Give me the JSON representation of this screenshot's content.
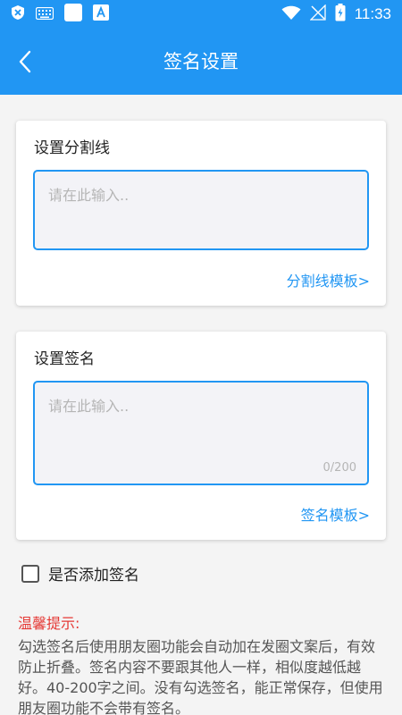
{
  "status_bar": {
    "time": "11:33"
  },
  "header": {
    "title": "签名设置"
  },
  "divider_card": {
    "title": "设置分割线",
    "placeholder": "请在此输入..",
    "template_link": "分割线模板>"
  },
  "signature_card": {
    "title": "设置签名",
    "placeholder": "请在此输入..",
    "counter": "0/200",
    "template_link": "签名模板>"
  },
  "add_signature": {
    "label": "是否添加签名",
    "checked": false
  },
  "tips": {
    "title": "温馨提示:",
    "body": "勾选签名后使用朋友圈功能会自动加在发圈文案后，有效防止折叠。签名内容不要跟其他人一样，相似度越低越好。40-200字之间。没有勾选签名，能正常保存，但使用朋友圈功能不会带有签名。"
  },
  "colors": {
    "primary": "#2196f3",
    "tip_title": "#e53935",
    "field_bg": "#f3f3f7"
  }
}
